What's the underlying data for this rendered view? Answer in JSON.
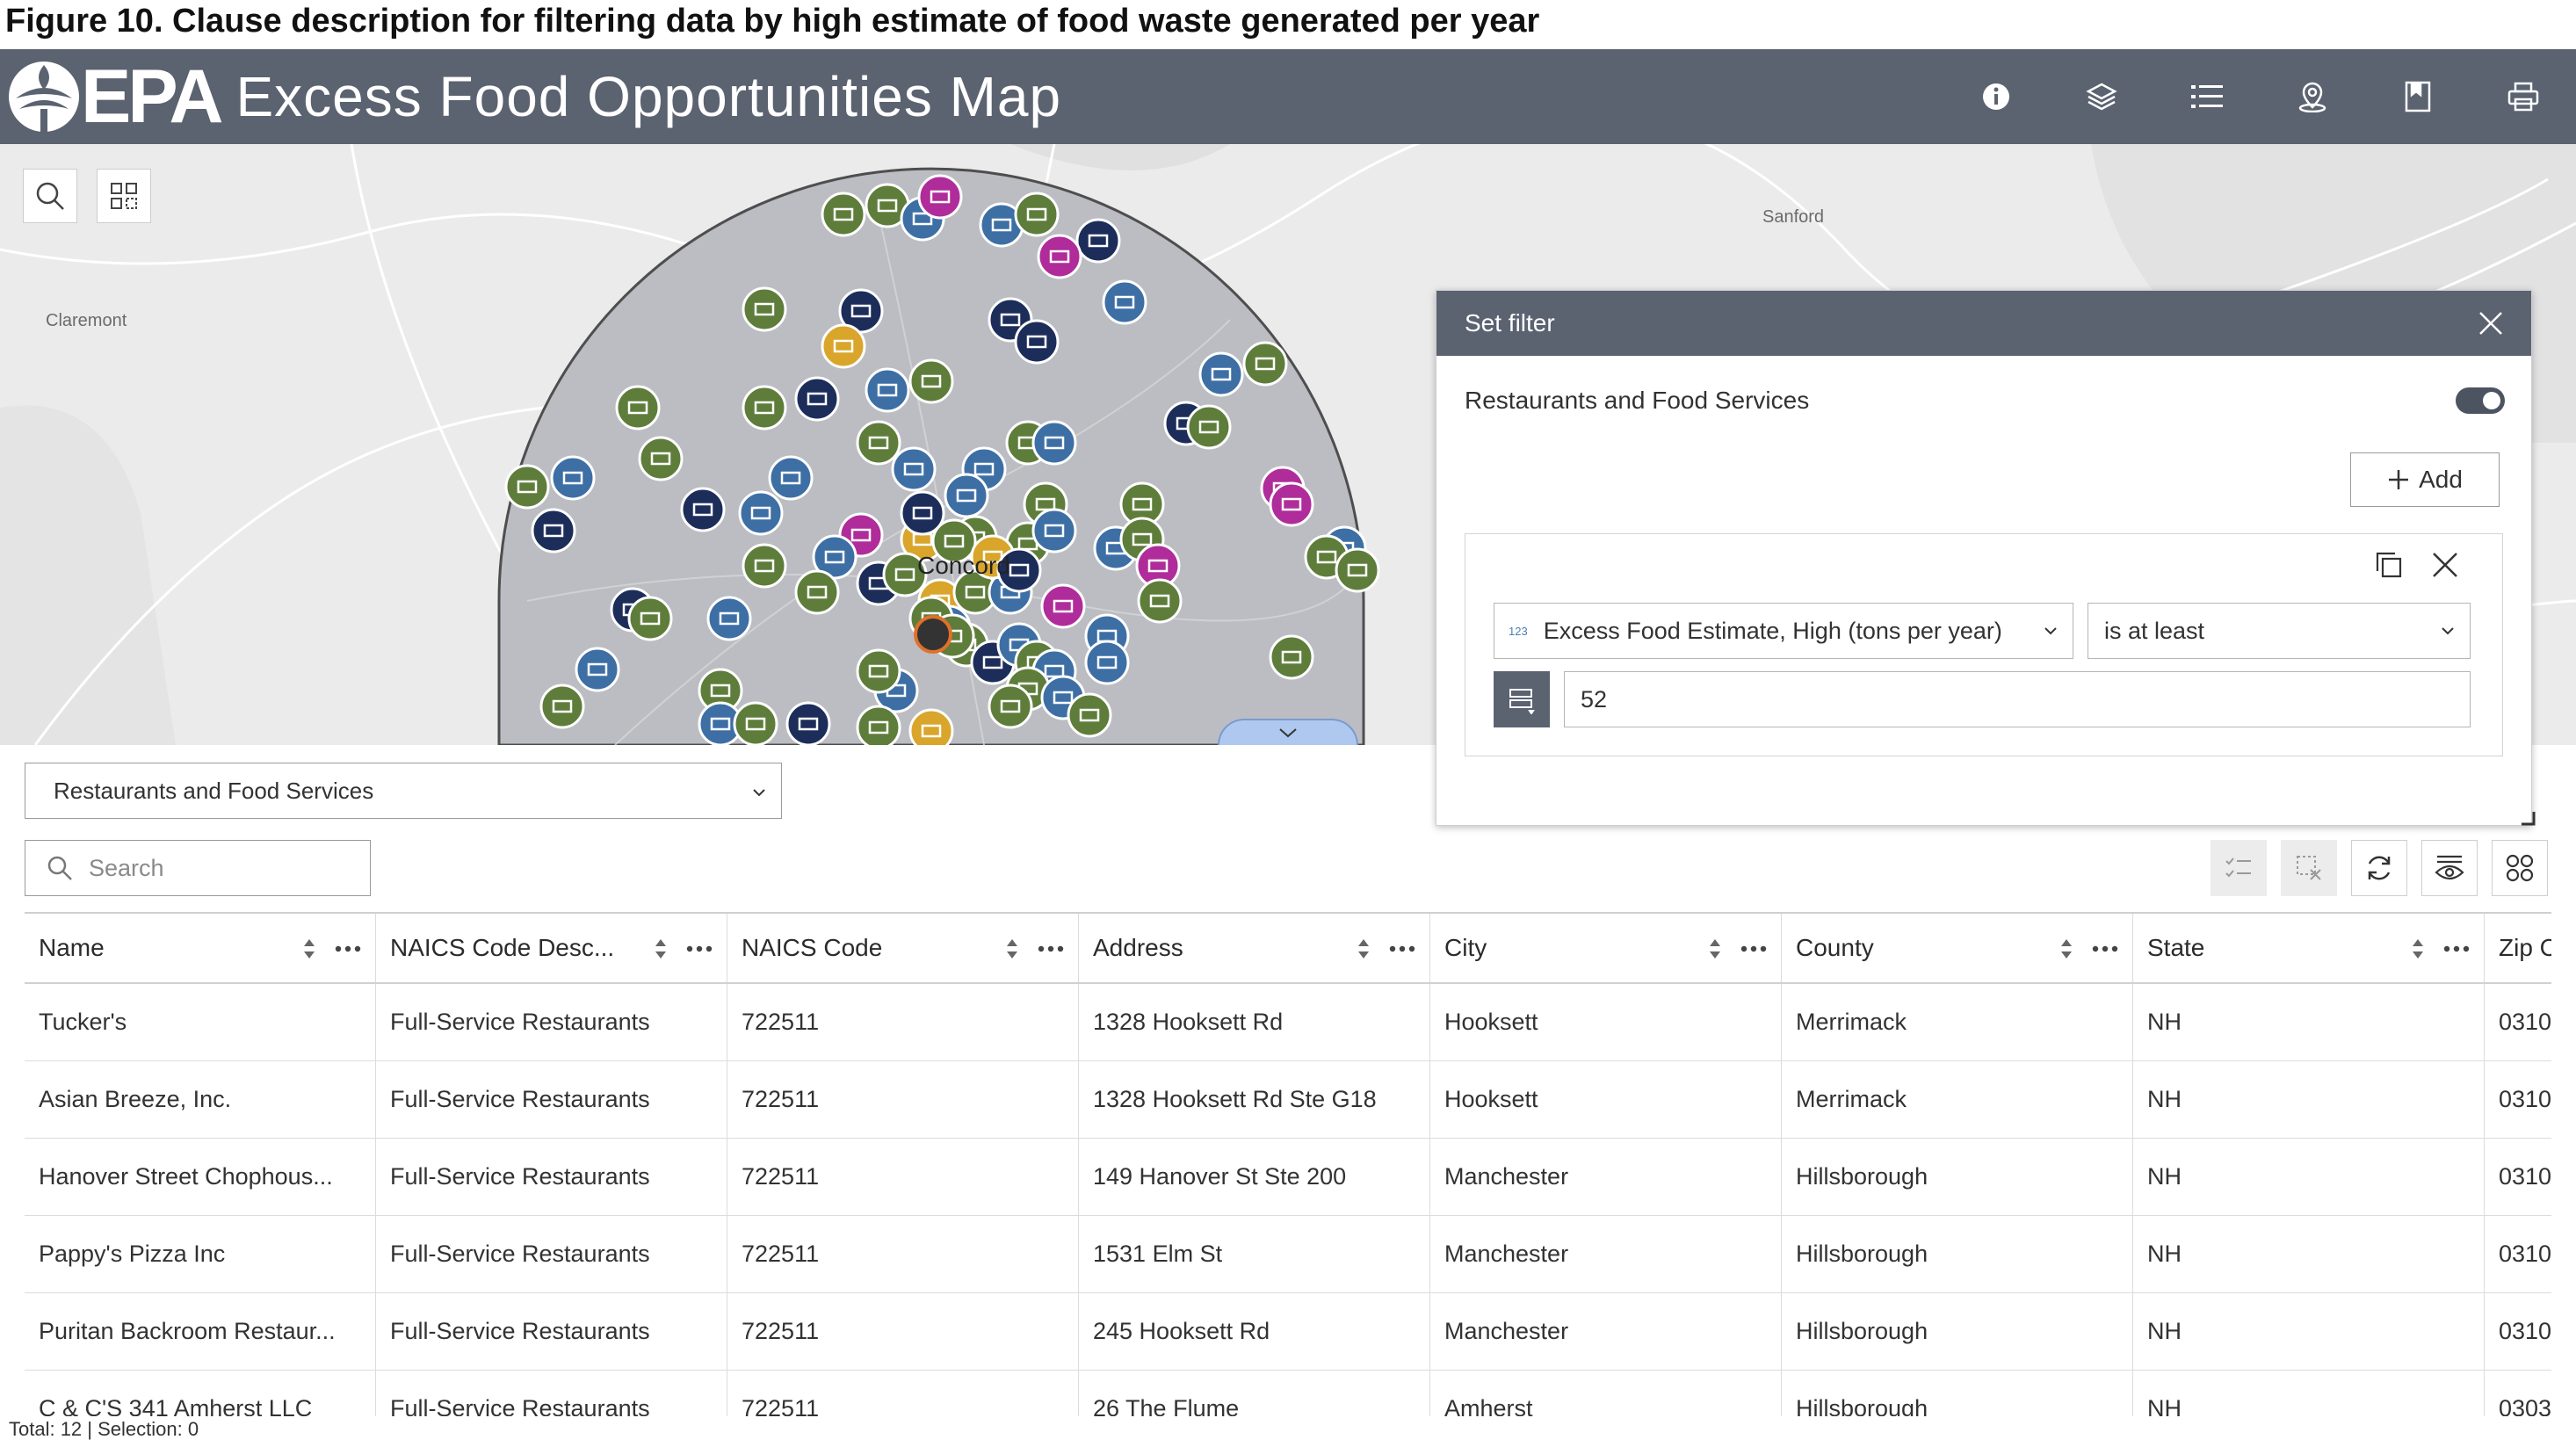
{
  "caption": "Figure 10. Clause description for filtering data by high estimate of food waste generated per year",
  "header": {
    "logo_text": "EPA",
    "title": "Excess Food Opportunities Map",
    "tools": [
      "info-icon",
      "layers-icon",
      "legend-list-icon",
      "location-pin-icon",
      "bookmark-icon",
      "print-icon"
    ]
  },
  "map": {
    "labels": [
      "Sanford",
      "Claremont",
      "Concord"
    ]
  },
  "filter_panel": {
    "title": "Set filter",
    "layer_name": "Restaurants and Food Services",
    "add_label": "Add",
    "field_type_badge": "123",
    "field": "Excess Food Estimate, High (tons per year)",
    "operator": "is at least",
    "value": "52"
  },
  "table_panel": {
    "layer_select": "Restaurants and Food Services",
    "search_placeholder": "Search",
    "columns": [
      "Name",
      "NAICS Code Desc...",
      "NAICS Code",
      "Address",
      "City",
      "County",
      "State",
      "Zip C"
    ],
    "rows": [
      [
        "Tucker's",
        "Full-Service Restaurants",
        "722511",
        "1328 Hooksett Rd",
        "Hooksett",
        "Merrimack",
        "NH",
        "0310"
      ],
      [
        "Asian Breeze, Inc.",
        "Full-Service Restaurants",
        "722511",
        "1328 Hooksett Rd Ste G18",
        "Hooksett",
        "Merrimack",
        "NH",
        "0310"
      ],
      [
        "Hanover Street Chophous...",
        "Full-Service Restaurants",
        "722511",
        "149 Hanover St Ste 200",
        "Manchester",
        "Hillsborough",
        "NH",
        "0310"
      ],
      [
        "Pappy's Pizza Inc",
        "Full-Service Restaurants",
        "722511",
        "1531 Elm St",
        "Manchester",
        "Hillsborough",
        "NH",
        "0310"
      ],
      [
        "Puritan Backroom Restaur...",
        "Full-Service Restaurants",
        "722511",
        "245 Hooksett Rd",
        "Manchester",
        "Hillsborough",
        "NH",
        "0310"
      ],
      [
        "C & C'S 341 Amherst LLC",
        "Full-Service Restaurants",
        "722511",
        "26 The Flume",
        "Amherst",
        "Hillsborough",
        "NH",
        "0303"
      ]
    ],
    "footer": "Total: 12 | Selection: 0"
  },
  "colors": {
    "header_bg": "#5b6270",
    "edu_green": "#5e7d3a",
    "store_blue": "#3d6fa5",
    "industry_navy": "#1d2d5a",
    "food_magenta": "#b02c9a",
    "gold": "#d9a52a"
  }
}
